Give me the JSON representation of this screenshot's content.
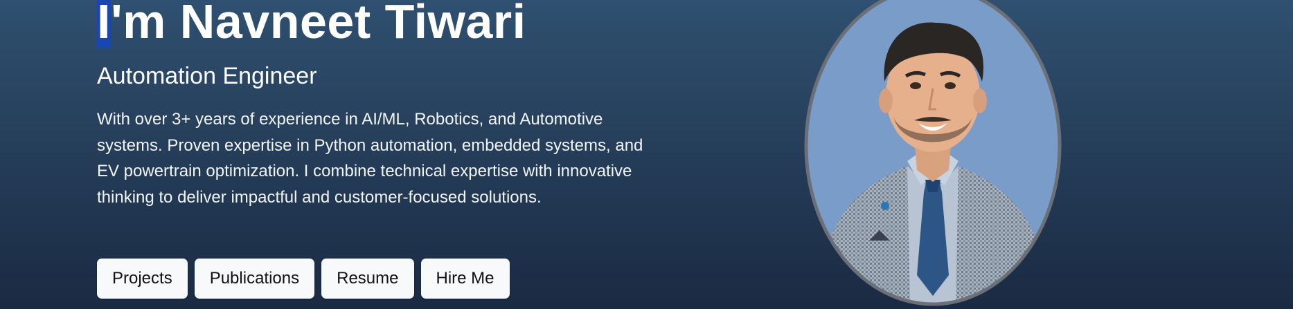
{
  "hero": {
    "name_highlight": "I",
    "name_rest": "'m Navneet Tiwari",
    "role": "Automation Engineer",
    "bio": "With over 3+ years of experience in AI/ML, Robotics, and Automotive systems. Proven expertise in Python automation, embedded systems, and EV powertrain optimization. I combine technical expertise with innovative thinking to deliver impactful and customer-focused solutions."
  },
  "buttons": {
    "projects": "Projects",
    "publications": "Publications",
    "resume": "Resume",
    "hire_me": "Hire Me"
  },
  "colors": {
    "background_top": "#2f5070",
    "background_bottom": "#1a2a42",
    "selection": "#1a46b4",
    "button_bg": "#f8f9fa",
    "photo_bg": "#7a9cc8",
    "photo_border": "#6b7078"
  }
}
